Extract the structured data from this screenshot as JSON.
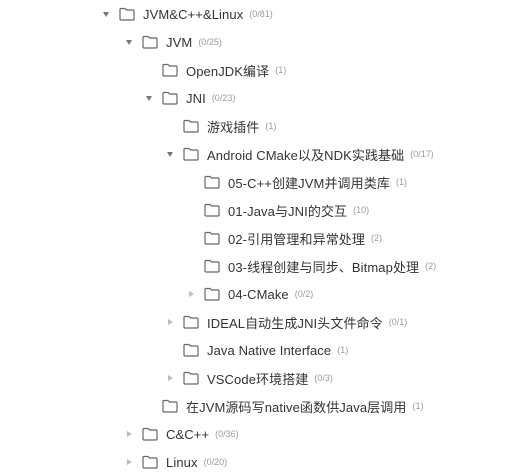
{
  "tree": {
    "items": [
      {
        "label": "JVM&C++&Linux",
        "count": "(0/81)",
        "state": "expanded"
      },
      {
        "label": "JVM",
        "count": "(0/25)",
        "state": "expanded"
      },
      {
        "label": "OpenJDK编译",
        "count": "(1)",
        "state": "leaf"
      },
      {
        "label": "JNI",
        "count": "(0/23)",
        "state": "expanded"
      },
      {
        "label": "游戏插件",
        "count": "(1)",
        "state": "leaf"
      },
      {
        "label": "Android CMake以及NDK实践基础",
        "count": "(0/17)",
        "state": "expanded"
      },
      {
        "label": "05-C++创建JVM并调用类库",
        "count": "(1)",
        "state": "leaf"
      },
      {
        "label": "01-Java与JNI的交互",
        "count": "(10)",
        "state": "leaf"
      },
      {
        "label": "02-引用管理和异常处理",
        "count": "(2)",
        "state": "leaf"
      },
      {
        "label": "03-线程创建与同步、Bitmap处理",
        "count": "(2)",
        "state": "leaf"
      },
      {
        "label": "04-CMake",
        "count": "(0/2)",
        "state": "collapsed"
      },
      {
        "label": "IDEAL自动生成JNI头文件命令",
        "count": "(0/1)",
        "state": "collapsed"
      },
      {
        "label": "Java Native Interface",
        "count": "(1)",
        "state": "leaf"
      },
      {
        "label": "VSCode环境搭建",
        "count": "(0/3)",
        "state": "collapsed"
      },
      {
        "label": "在JVM源码写native函数供Java层调用",
        "count": "(1)",
        "state": "leaf"
      },
      {
        "label": "C&C++",
        "count": "(0/36)",
        "state": "collapsed"
      },
      {
        "label": "Linux",
        "count": "(0/20)",
        "state": "collapsed"
      }
    ]
  },
  "colors": {
    "text": "#333333",
    "count": "#9a9a9a",
    "icon": "#666666",
    "arrow_expanded": "#777777",
    "arrow_collapsed": "#bdbdbd"
  }
}
